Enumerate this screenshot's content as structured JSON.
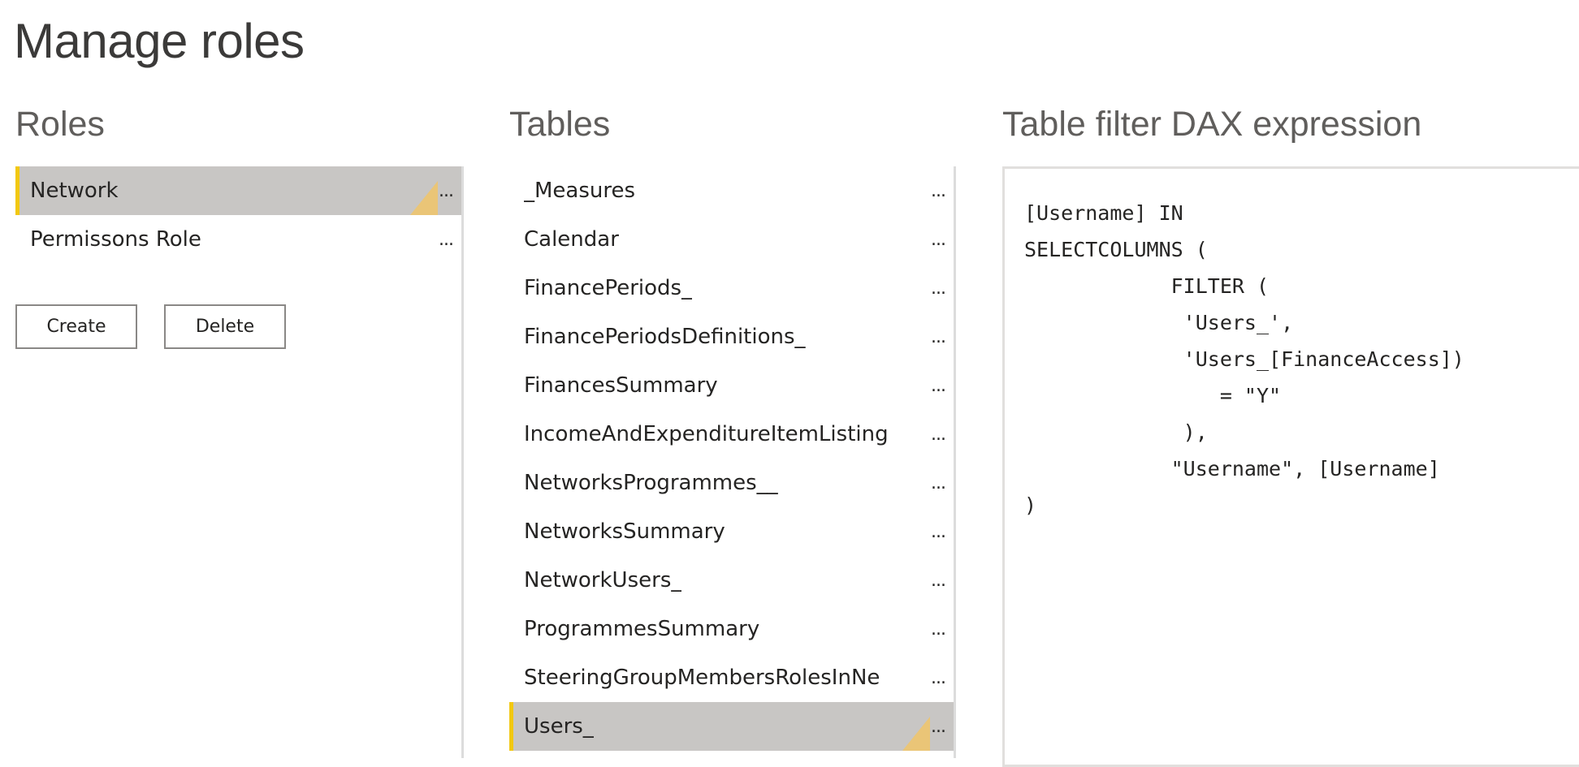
{
  "page_title": "Manage roles",
  "roles": {
    "title": "Roles",
    "items": [
      {
        "label": "Network",
        "selected": true
      },
      {
        "label": "Permissons Role",
        "selected": false
      }
    ],
    "more_label": "...",
    "create_label": "Create",
    "delete_label": "Delete"
  },
  "tables": {
    "title": "Tables",
    "items": [
      {
        "label": "_Measures",
        "selected": false
      },
      {
        "label": "Calendar",
        "selected": false
      },
      {
        "label": "FinancePeriods_",
        "selected": false
      },
      {
        "label": "FinancePeriodsDefinitions_",
        "selected": false
      },
      {
        "label": "FinancesSummary",
        "selected": false
      },
      {
        "label": "IncomeAndExpenditureItemListing",
        "selected": false
      },
      {
        "label": "NetworksProgrammes__",
        "selected": false
      },
      {
        "label": "NetworksSummary",
        "selected": false
      },
      {
        "label": "NetworkUsers_",
        "selected": false
      },
      {
        "label": "ProgrammesSummary",
        "selected": false
      },
      {
        "label": "SteeringGroupMembersRolesInNe",
        "selected": false
      },
      {
        "label": "Users_",
        "selected": true
      }
    ],
    "more_label": "..."
  },
  "dax": {
    "title": "Table filter DAX expression",
    "expression": "[Username] IN\nSELECTCOLUMNS (\n            FILTER (\n             'Users_',\n             'Users_[FinanceAccess])\n                = \"Y\"\n             ),\n            \"Username\", [Username]\n)"
  },
  "colors": {
    "selected_background": "#c8c6c4",
    "selected_accent": "#f2c811",
    "flag": "#f0c46a",
    "divider": "#dcdcdc"
  }
}
